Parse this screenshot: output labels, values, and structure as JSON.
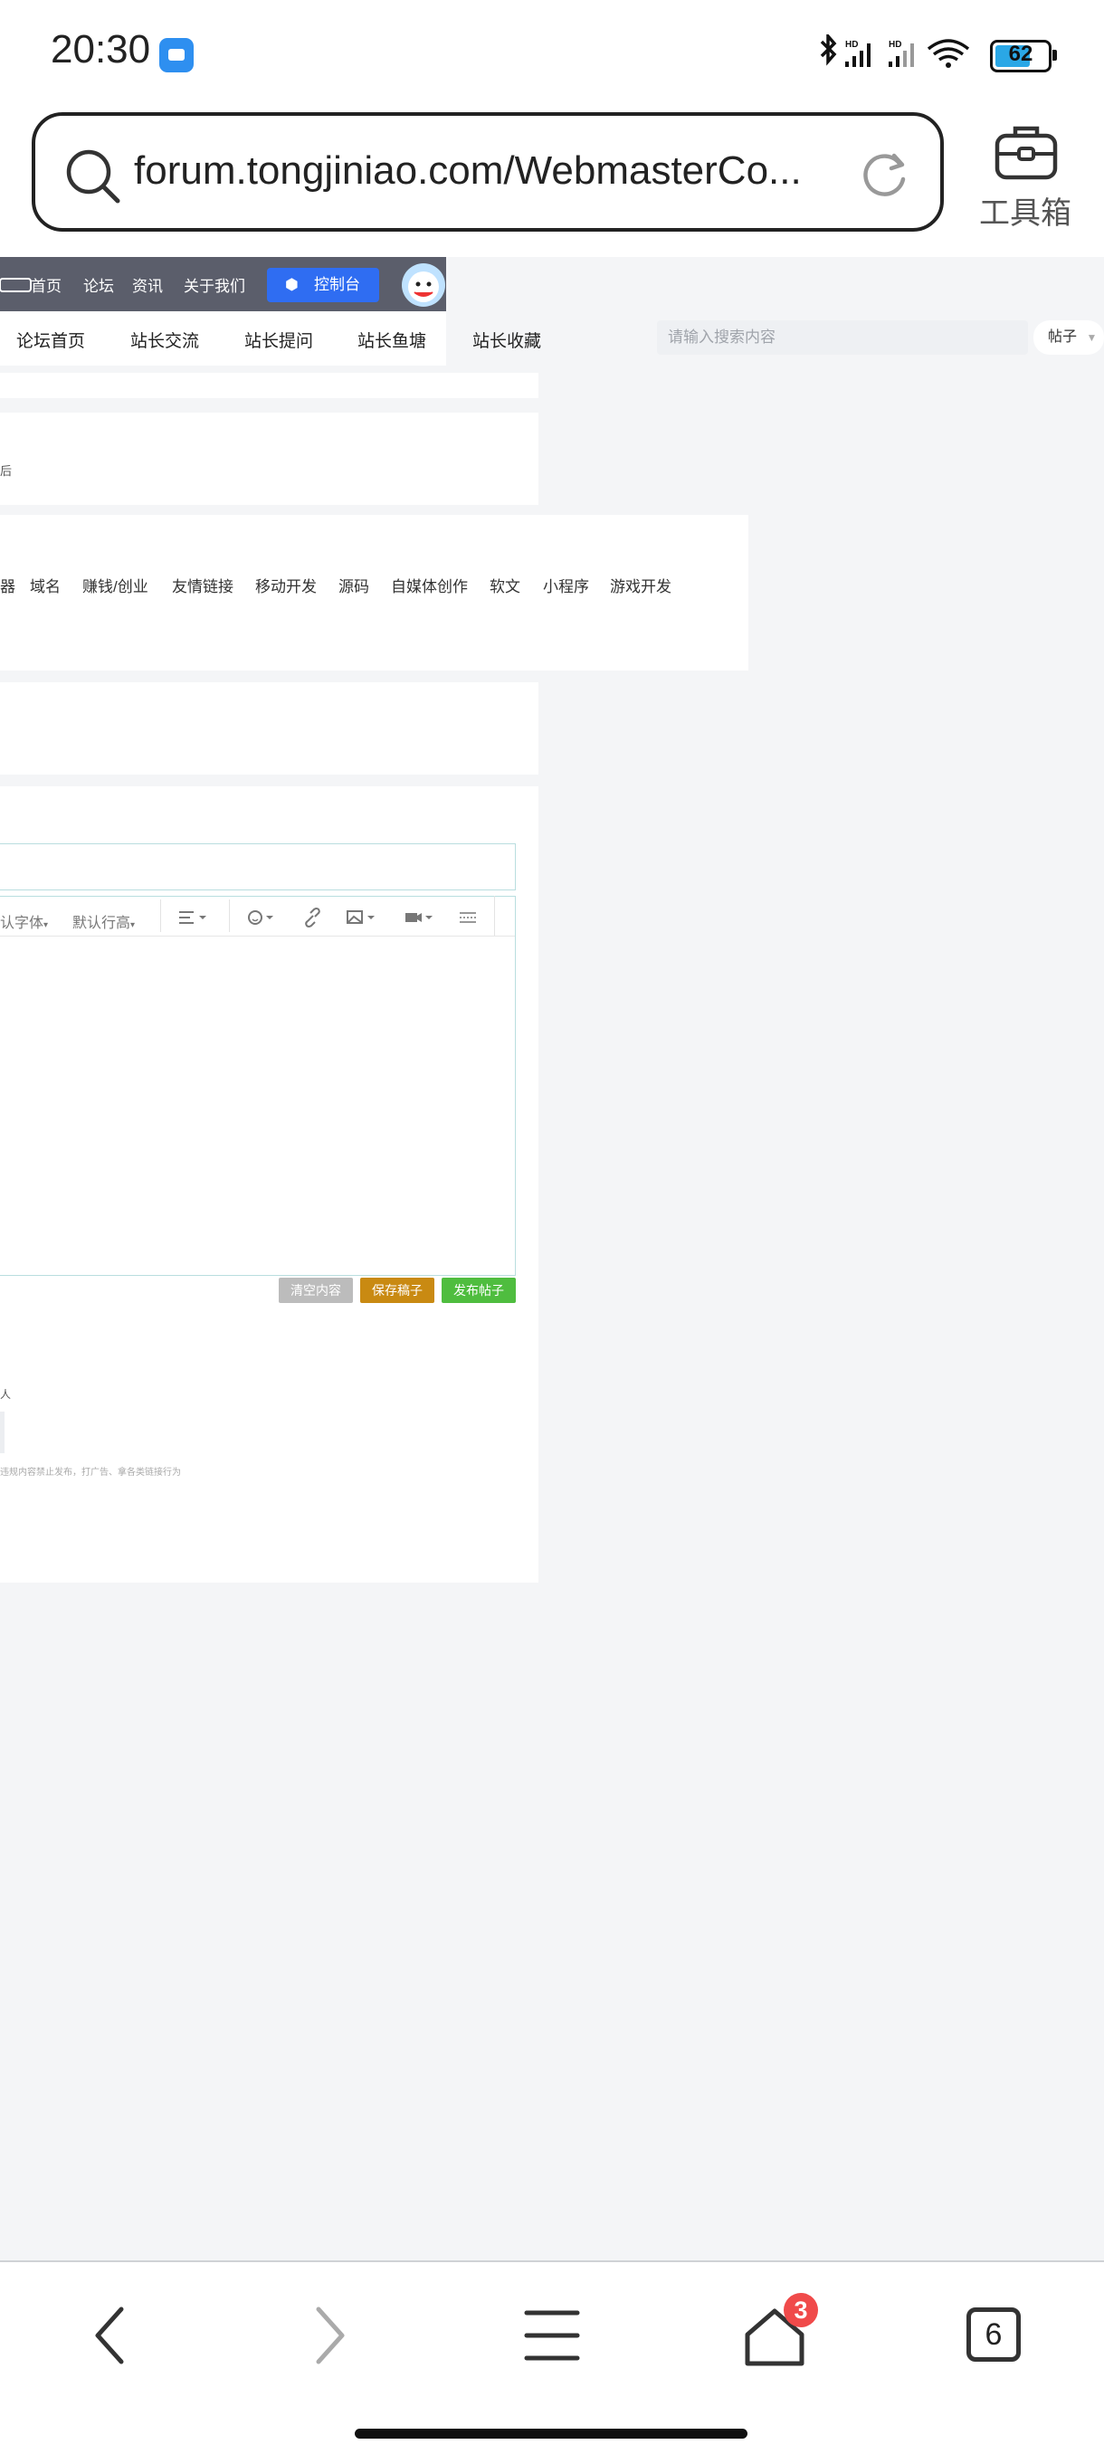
{
  "status_bar": {
    "time": "20:30",
    "battery_level": "62",
    "icons": [
      "camera-app-icon",
      "bluetooth-icon",
      "signal-icon",
      "signal-icon",
      "wifi-icon",
      "battery-icon"
    ]
  },
  "browser": {
    "url": "forum.tongjiniao.com/WebmasterCo...",
    "toolbox_label": "工具箱",
    "tab_count": "6",
    "home_badge": "3"
  },
  "site": {
    "top_nav": [
      "首页",
      "论坛",
      "资讯",
      "关于我们"
    ],
    "console_label": "控制台",
    "sub_nav": [
      "论坛首页",
      "站长交流",
      "站长提问",
      "站长鱼塘",
      "站长收藏"
    ],
    "search_placeholder": "请输入搜索内容",
    "search_type": "帖子",
    "categories": [
      "器",
      "域名",
      "赚钱/创业",
      "友情链接",
      "移动开发",
      "源码",
      "自媒体创作",
      "软文",
      "小程序",
      "游戏开发"
    ],
    "editor": {
      "font_label": "认字体",
      "line_height_label": "默认行高"
    },
    "buttons": {
      "clear": "清空内容",
      "save": "保存稿子",
      "publish": "发布帖子"
    },
    "fragment_top_card": "后",
    "fragment_bottom_card": "人",
    "disclaimer_fragment": "违规内容禁止发布，打广告、拿各类链接行为"
  },
  "colors": {
    "console": "#2f6df2",
    "save_button": "#c98a12",
    "publish_button": "#4fbd3f",
    "clear_button": "#bcbcbc",
    "home_badge": "#f04a4a"
  }
}
